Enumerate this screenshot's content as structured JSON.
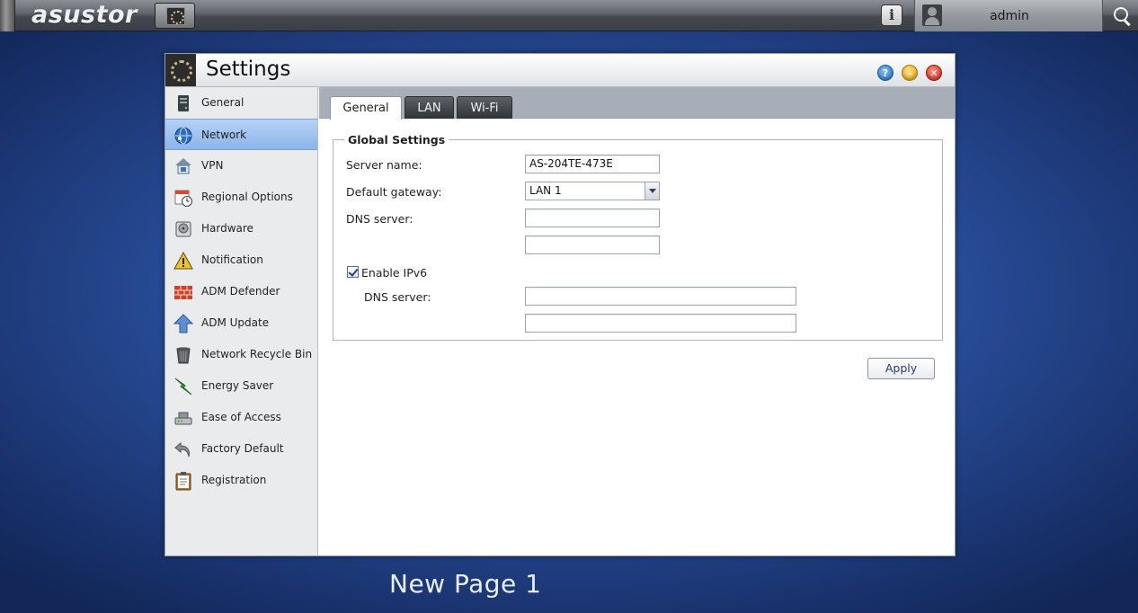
{
  "topbar": {
    "brand": "asustor",
    "user_name": "admin"
  },
  "window": {
    "title": "Settings",
    "buttons": {
      "help": "?",
      "minimize": "–",
      "close": "✕"
    }
  },
  "sidebar": {
    "items": [
      {
        "label": "General",
        "icon": "server-icon"
      },
      {
        "label": "Network",
        "icon": "globe-network-icon",
        "active": true
      },
      {
        "label": "VPN",
        "icon": "vpn-house-icon"
      },
      {
        "label": "Regional Options",
        "icon": "calendar-clock-icon"
      },
      {
        "label": "Hardware",
        "icon": "hard-drive-icon"
      },
      {
        "label": "Notification",
        "icon": "warning-triangle-icon"
      },
      {
        "label": "ADM Defender",
        "icon": "firewall-brick-icon"
      },
      {
        "label": "ADM Update",
        "icon": "update-arrow-icon"
      },
      {
        "label": "Network Recycle Bin",
        "icon": "trash-bin-icon"
      },
      {
        "label": "Energy Saver",
        "icon": "energy-bolt-icon"
      },
      {
        "label": "Ease of Access",
        "icon": "router-device-icon"
      },
      {
        "label": "Factory Default",
        "icon": "undo-arrow-icon"
      },
      {
        "label": "Registration",
        "icon": "clipboard-icon"
      }
    ]
  },
  "tabs": [
    {
      "label": "General",
      "active": true
    },
    {
      "label": "LAN"
    },
    {
      "label": "Wi-Fi"
    }
  ],
  "form": {
    "legend": "Global Settings",
    "server_name_label": "Server name:",
    "server_name_value": "AS-204TE-473E",
    "gateway_label": "Default gateway:",
    "gateway_value": "LAN 1",
    "dns_label": "DNS server:",
    "dns1_value": "",
    "dns2_value": "",
    "ipv6_label": "Enable IPv6",
    "ipv6_checked": true,
    "ipv6_dns_label": "DNS server:",
    "ipv6_dns1_value": "",
    "ipv6_dns2_value": "",
    "apply_label": "Apply"
  },
  "page_label": "New Page 1",
  "colors": {
    "sidebar_active": "#8cb5ea",
    "tabstrip": "#a7aeb7",
    "desktop": "#2a4f9c"
  }
}
